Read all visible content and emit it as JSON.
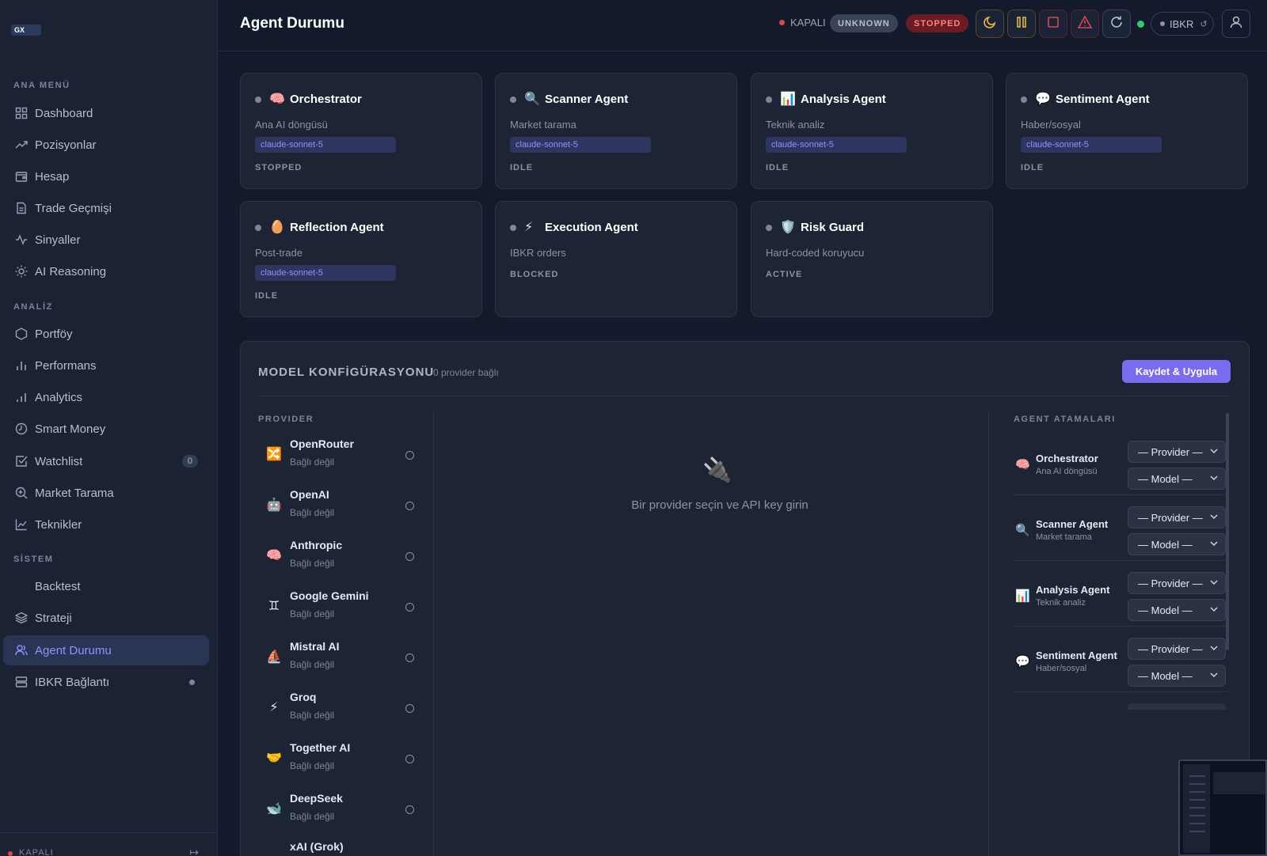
{
  "sidebar": {
    "logo_text": "GX",
    "sections": {
      "main": "ANA MENÜ",
      "analysis": "ANALİZ",
      "system": "SİSTEM"
    },
    "items": [
      {
        "label": "Dashboard",
        "icon": "grid-icon"
      },
      {
        "label": "Pozisyonlar",
        "icon": "trending-up-icon"
      },
      {
        "label": "Hesap",
        "icon": "wallet-icon"
      },
      {
        "label": "Trade Geçmişi",
        "icon": "document-icon"
      },
      {
        "label": "Sinyaller",
        "icon": "pulse-icon"
      },
      {
        "label": "AI Reasoning",
        "icon": "sun-icon"
      },
      {
        "label": "Portföy",
        "icon": "hexagon-icon"
      },
      {
        "label": "Performans",
        "icon": "bar-chart-icon"
      },
      {
        "label": "Analytics",
        "icon": "bar-chart-icon"
      },
      {
        "label": "Smart Money",
        "icon": "clock-icon"
      },
      {
        "label": "Watchlist",
        "icon": "checkbox-icon",
        "badge": "0"
      },
      {
        "label": "Market Tarama",
        "icon": "search-plus-icon"
      },
      {
        "label": "Teknikler",
        "icon": "line-chart-icon"
      },
      {
        "label": "Backtest",
        "icon": ""
      },
      {
        "label": "Strateji",
        "icon": "layers-icon"
      },
      {
        "label": "Agent Durumu",
        "icon": "users-icon",
        "active": true
      },
      {
        "label": "IBKR Bağlantı",
        "icon": "server-icon"
      }
    ],
    "footer_status": "KAPALI"
  },
  "header": {
    "title": "Agent Durumu",
    "connection_status": "KAPALI",
    "badge_unknown": "UNKNOWN",
    "badge_stopped": "STOPPED",
    "ibkr_label": "IBKR",
    "colors": {
      "danger": "#e0454a",
      "ok": "#2ecc71",
      "accent": "#7a6cf0",
      "warn": "#e7b93b"
    }
  },
  "agents": [
    {
      "name": "Orchestrator",
      "emoji": "🧠",
      "desc": "Ana AI döngüsü",
      "model": "claude-sonnet-5",
      "status": "STOPPED"
    },
    {
      "name": "Scanner Agent",
      "emoji": "🔍",
      "desc": "Market tarama",
      "model": "claude-sonnet-5",
      "status": "IDLE"
    },
    {
      "name": "Analysis Agent",
      "emoji": "📊",
      "desc": "Teknik analiz",
      "model": "claude-sonnet-5",
      "status": "IDLE"
    },
    {
      "name": "Sentiment Agent",
      "emoji": "💬",
      "desc": "Haber/sosyal",
      "model": "claude-sonnet-5",
      "status": "IDLE"
    },
    {
      "name": "Reflection Agent",
      "emoji": "🥚",
      "desc": "Post-trade",
      "model": "claude-sonnet-5",
      "status": "IDLE"
    },
    {
      "name": "Execution Agent",
      "emoji": "⚡",
      "desc": "IBKR orders",
      "model": "",
      "status": "BLOCKED"
    },
    {
      "name": "Risk Guard",
      "emoji": "🛡️",
      "desc": "Hard-coded koruyucu",
      "model": "",
      "status": "ACTIVE"
    }
  ],
  "model_config": {
    "title": "MODEL KONFİGÜRASYONU",
    "subtitle": "0 provider bağlı",
    "save_label": "Kaydet & Uygula",
    "provider_header": "PROVIDER",
    "assign_header": "AGENT ATAMALARI",
    "empty_icon": "🔌",
    "empty_text": "Bir provider seçin ve API key girin",
    "providers": [
      {
        "name": "OpenRouter",
        "status": "Bağlı değil",
        "icon": "🔀"
      },
      {
        "name": "OpenAI",
        "status": "Bağlı değil",
        "icon": "🤖"
      },
      {
        "name": "Anthropic",
        "status": "Bağlı değil",
        "icon": "🧠"
      },
      {
        "name": "Google Gemini",
        "status": "Bağlı değil",
        "icon": "♊"
      },
      {
        "name": "Mistral AI",
        "status": "Bağlı değil",
        "icon": "⛵"
      },
      {
        "name": "Groq",
        "status": "Bağlı değil",
        "icon": "⚡"
      },
      {
        "name": "Together AI",
        "status": "Bağlı değil",
        "icon": "🤝"
      },
      {
        "name": "DeepSeek",
        "status": "Bağlı değil",
        "icon": "🐋"
      },
      {
        "name": "xAI (Grok)",
        "status": "",
        "icon": ""
      }
    ],
    "assignments": [
      {
        "name": "Orchestrator",
        "desc": "Ana AI döngüsü",
        "emoji": "🧠",
        "provider": "— Provider —",
        "model": "— Model —"
      },
      {
        "name": "Scanner Agent",
        "desc": "Market tarama",
        "emoji": "🔍",
        "provider": "— Provider —",
        "model": "— Model —"
      },
      {
        "name": "Analysis Agent",
        "desc": "Teknik analiz",
        "emoji": "📊",
        "provider": "— Provider —",
        "model": "— Model —"
      },
      {
        "name": "Sentiment Agent",
        "desc": "Haber/sosyal",
        "emoji": "💬",
        "provider": "— Provider —",
        "model": "— Model —"
      }
    ]
  }
}
